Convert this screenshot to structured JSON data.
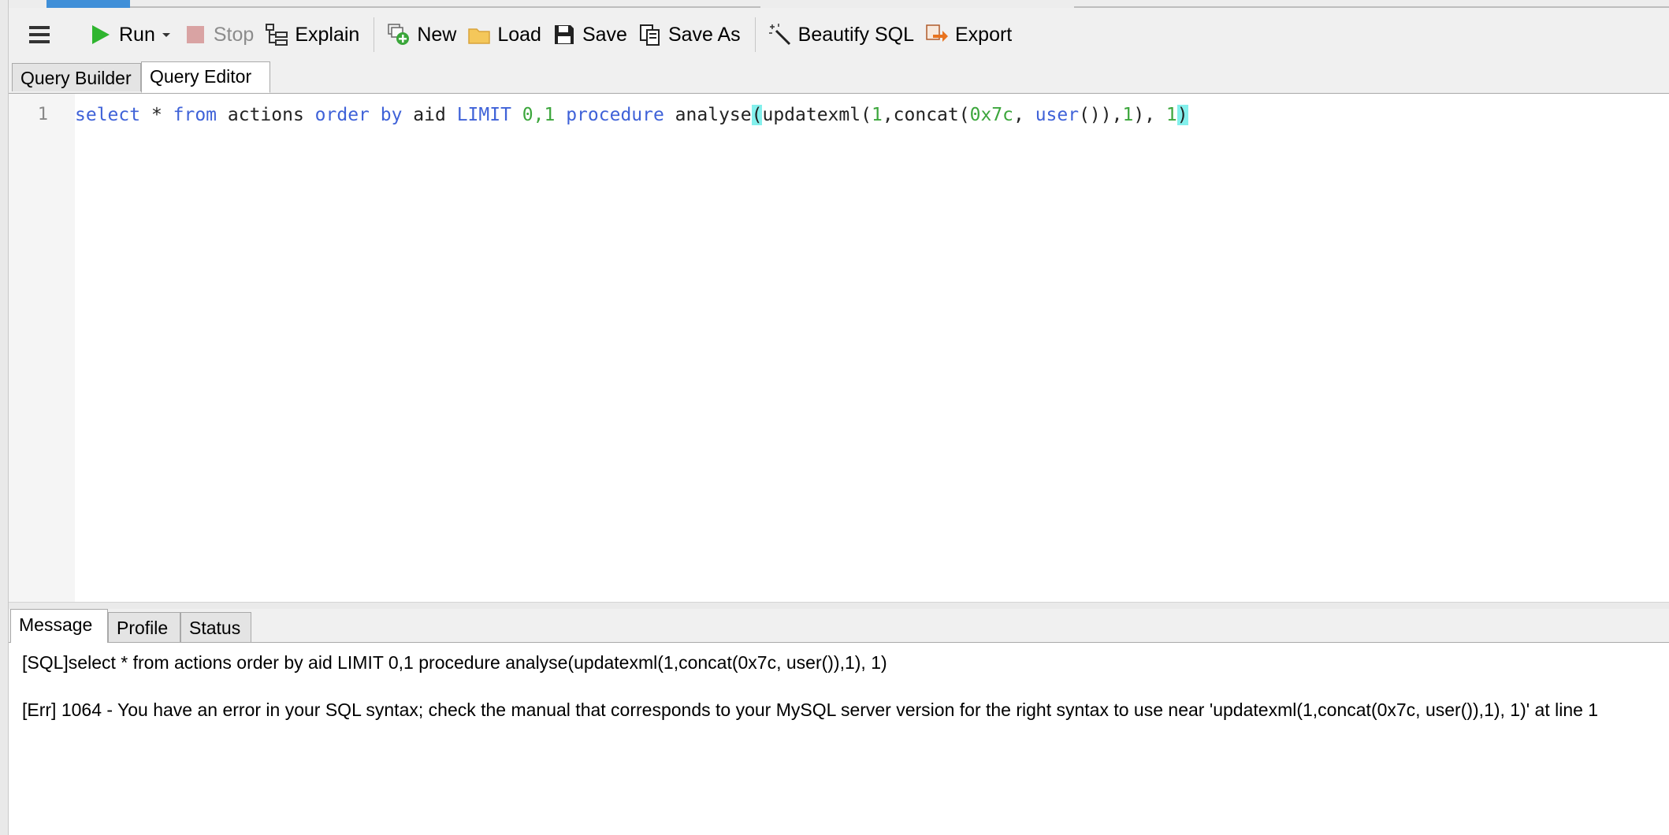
{
  "toolbar": {
    "menu_icon": "hamburger-icon",
    "run": "Run",
    "stop": "Stop",
    "explain": "Explain",
    "new": "New",
    "load": "Load",
    "save": "Save",
    "save_as": "Save As",
    "beautify": "Beautify SQL",
    "export": "Export"
  },
  "editor_tabs": [
    "Query Builder",
    "Query Editor"
  ],
  "editor": {
    "line_number": "1",
    "tokens": {
      "t1": "select",
      "t2": " * ",
      "t3": "from",
      "t4": " actions ",
      "t5": "order by",
      "t6": " aid ",
      "t7": "LIMIT",
      "t8": " ",
      "t9": "0,1",
      "t10": " ",
      "t11": "procedure",
      "t12": " analyse",
      "t13": "(",
      "t14": "updatexml(",
      "t15": "1",
      "t16": ",concat(",
      "t17": "0x7c",
      "t18": ", ",
      "t19": "user",
      "t20": "()),",
      "t21": "1",
      "t22": "), ",
      "t23": "1",
      "t24": ")"
    }
  },
  "result_tabs": [
    "Message",
    "Profile",
    "Status"
  ],
  "messages": {
    "sql": "[SQL]select * from actions order by aid LIMIT 0,1 procedure analyse(updatexml(1,concat(0x7c, user()),1), 1)",
    "err": "[Err] 1064 - You have an error in your SQL syntax; check the manual that corresponds to your MySQL server version for the right syntax to use near 'updatexml(1,concat(0x7c, user()),1), 1)' at line 1"
  },
  "colors": {
    "keyword": "#3f62d8",
    "number": "#3ca63c",
    "bracket_highlight": "#83f0ec",
    "run_green": "#2fb52f"
  }
}
